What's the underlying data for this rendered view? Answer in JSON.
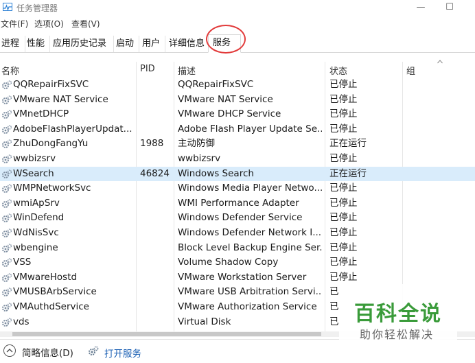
{
  "window": {
    "title": "任务管理器",
    "minimize_glyph": "—",
    "maximize_glyph": "☐"
  },
  "menu": [
    "文件(F)",
    "选项(O)",
    "查看(V)"
  ],
  "tabs": [
    "进程",
    "性能",
    "应用历史记录",
    "启动",
    "用户",
    "详细信息",
    "服务"
  ],
  "active_tab": "服务",
  "columns": [
    "名称",
    "PID",
    "描述",
    "状态",
    "组"
  ],
  "services": [
    {
      "name": "QQRepairFixSVC",
      "pid": "",
      "desc": "QQRepairFixSVC",
      "status": "已停止",
      "group": ""
    },
    {
      "name": "VMware NAT Service",
      "pid": "",
      "desc": "VMware NAT Service",
      "status": "已停止",
      "group": ""
    },
    {
      "name": "VMnetDHCP",
      "pid": "",
      "desc": "VMware DHCP Service",
      "status": "已停止",
      "group": ""
    },
    {
      "name": "AdobeFlashPlayerUpdat...",
      "pid": "",
      "desc": "Adobe Flash Player Update Se...",
      "status": "已停止",
      "group": ""
    },
    {
      "name": "ZhuDongFangYu",
      "pid": "1988",
      "desc": "主动防御",
      "status": "正在运行",
      "group": ""
    },
    {
      "name": "wwbizsrv",
      "pid": "",
      "desc": "wwbizsrv",
      "status": "已停止",
      "group": ""
    },
    {
      "name": "WSearch",
      "pid": "46824",
      "desc": "Windows Search",
      "status": "正在运行",
      "group": "",
      "selected": true
    },
    {
      "name": "WMPNetworkSvc",
      "pid": "",
      "desc": "Windows Media Player Netwo...",
      "status": "已停止",
      "group": ""
    },
    {
      "name": "wmiApSrv",
      "pid": "",
      "desc": "WMI Performance Adapter",
      "status": "已停止",
      "group": ""
    },
    {
      "name": "WinDefend",
      "pid": "",
      "desc": "Windows Defender Service",
      "status": "已停止",
      "group": ""
    },
    {
      "name": "WdNisSvc",
      "pid": "",
      "desc": "Windows Defender Network I...",
      "status": "已停止",
      "group": ""
    },
    {
      "name": "wbengine",
      "pid": "",
      "desc": "Block Level Backup Engine Ser...",
      "status": "已停止",
      "group": ""
    },
    {
      "name": "VSS",
      "pid": "",
      "desc": "Volume Shadow Copy",
      "status": "已停止",
      "group": ""
    },
    {
      "name": "VMwareHostd",
      "pid": "",
      "desc": "VMware Workstation Server",
      "status": "已停止",
      "group": ""
    },
    {
      "name": "VMUSBArbService",
      "pid": "",
      "desc": "VMware USB Arbitration Servi...",
      "status": "已",
      "group": ""
    },
    {
      "name": "VMAuthdService",
      "pid": "",
      "desc": "VMware Authorization Service",
      "status": "已",
      "group": ""
    },
    {
      "name": "vds",
      "pid": "",
      "desc": "Virtual Disk",
      "status": "已",
      "group": ""
    }
  ],
  "footer": {
    "brief_label": "简略信息(D)",
    "open_services_label": "打开服务"
  },
  "watermark": {
    "title": "百科全说",
    "subtitle": "助你轻松解决"
  },
  "colors": {
    "selected_row": "#d9ecfb",
    "highlight_circle": "#e23b3b",
    "watermark_green": "#3a9b3a",
    "link_blue": "#1a5fb4"
  }
}
